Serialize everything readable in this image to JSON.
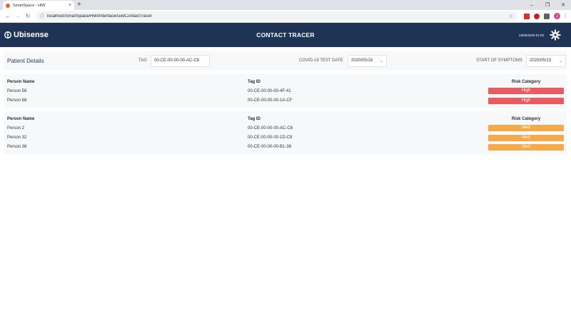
{
  "browser": {
    "tab_title": "SmartSpace - HMI",
    "tab_close": "×",
    "new_tab": "+",
    "url": "localhost/SmartSpace/HMI/Interface/Get/ContactTracer",
    "profile_initial": "J",
    "window_controls": {
      "minimize": "–",
      "maximize": "❐",
      "close": "✕"
    }
  },
  "header": {
    "logo_text": "Ubisense",
    "title": "CONTACT TRACER",
    "datetime": "23/05/2020 01:03"
  },
  "filters": {
    "panel_title": "Patient Details",
    "tag_label": "TAG",
    "tag_value": "00-CE-00-00-00-AC-C8",
    "test_date_label": "COVID-19 TEST DATE",
    "test_date_value": "2020/05/18",
    "symptoms_label": "START OF SYMPTOMS",
    "symptoms_value": "2020/05/13"
  },
  "tables": [
    {
      "headers": {
        "name": "Person Name",
        "tag": "Tag ID",
        "risk": "Risk Category"
      },
      "rows": [
        {
          "name": "Person 56",
          "tag": "00-CE-00-00-00-4F-41",
          "risk": "High"
        },
        {
          "name": "Person 68",
          "tag": "00-CE-00-00-00-1A-CF",
          "risk": "High"
        }
      ]
    },
    {
      "headers": {
        "name": "Person Name",
        "tag": "Tag ID",
        "risk": "Risk Category"
      },
      "rows": [
        {
          "name": "Person 2",
          "tag": "00-CE-00-00-00-AC-C8",
          "risk": "Med"
        },
        {
          "name": "Person 32",
          "tag": "00-CE-00-00-00-1D-C9",
          "risk": "Med"
        },
        {
          "name": "Person 38",
          "tag": "00-CE-00-00-00-B1-38",
          "risk": "Med"
        }
      ]
    }
  ],
  "colors": {
    "header_bg": "#1f3354",
    "risk_high": "#eb5b5f",
    "risk_med": "#f4a94a"
  },
  "icons": {
    "logo": "ubisense-logo-icon",
    "settings": "gear-icon"
  }
}
